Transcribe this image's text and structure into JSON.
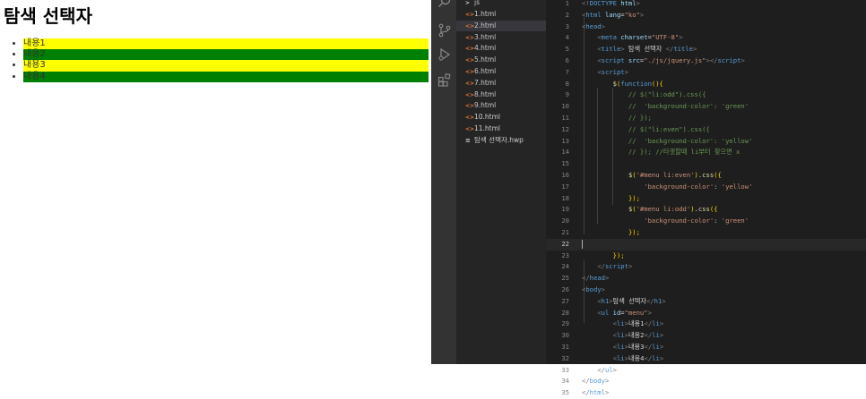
{
  "preview": {
    "title": "탐색 선택자",
    "items": [
      "내용1",
      "내용2",
      "내용3",
      "내용4"
    ],
    "even_color": "#ffff00",
    "odd_color": "#008000"
  },
  "activity_icons": [
    "search-icon",
    "source-control-icon",
    "run-debug-icon",
    "extensions-icon"
  ],
  "explorer": {
    "folder": "js",
    "files": [
      "1.html",
      "2.html",
      "3.html",
      "4.html",
      "5.html",
      "6.html",
      "7.html",
      "8.html",
      "9.html",
      "10.html",
      "11.html"
    ],
    "active_file": "2.html",
    "hwp_file": "탐색 선택자.hwp"
  },
  "code": {
    "lines": [
      {
        "n": "1",
        "t": [
          [
            "t-brk",
            "<!"
          ],
          [
            "t-tag",
            "DOCTYPE"
          ],
          [
            "t-attr",
            " html"
          ],
          [
            "t-brk",
            ">"
          ]
        ]
      },
      {
        "n": "2",
        "t": [
          [
            "t-brk",
            "<"
          ],
          [
            "t-tag",
            "html"
          ],
          [
            "t-attr",
            " lang"
          ],
          [
            "t-txt",
            "="
          ],
          [
            "t-str",
            "\"ko\""
          ],
          [
            "t-brk",
            ">"
          ]
        ]
      },
      {
        "n": "3",
        "t": [
          [
            "t-brk",
            "<"
          ],
          [
            "t-tag",
            "head"
          ],
          [
            "t-brk",
            ">"
          ]
        ]
      },
      {
        "n": "4",
        "t": [
          [
            "t-txt",
            "    "
          ],
          [
            "t-brk",
            "<"
          ],
          [
            "t-tag",
            "meta"
          ],
          [
            "t-attr",
            " charset"
          ],
          [
            "t-txt",
            "="
          ],
          [
            "t-str",
            "\"UTF-8\""
          ],
          [
            "t-brk",
            ">"
          ]
        ]
      },
      {
        "n": "5",
        "t": [
          [
            "t-txt",
            "    "
          ],
          [
            "t-brk",
            "<"
          ],
          [
            "t-tag",
            "title"
          ],
          [
            "t-brk",
            ">"
          ],
          [
            "t-txt",
            " 탐색 선택자 "
          ],
          [
            "t-brk",
            "</"
          ],
          [
            "t-tag",
            "title"
          ],
          [
            "t-brk",
            ">"
          ]
        ]
      },
      {
        "n": "6",
        "t": [
          [
            "t-txt",
            "    "
          ],
          [
            "t-brk",
            "<"
          ],
          [
            "t-tag",
            "script"
          ],
          [
            "t-attr",
            " src"
          ],
          [
            "t-txt",
            "="
          ],
          [
            "t-str",
            "\"./js/jquery.js\""
          ],
          [
            "t-brk",
            "></"
          ],
          [
            "t-tag",
            "script"
          ],
          [
            "t-brk",
            ">"
          ]
        ]
      },
      {
        "n": "7",
        "t": [
          [
            "t-txt",
            "    "
          ],
          [
            "t-brk",
            "<"
          ],
          [
            "t-tag",
            "script"
          ],
          [
            "t-brk",
            ">"
          ]
        ]
      },
      {
        "n": "8",
        "t": [
          [
            "t-txt",
            "        "
          ],
          [
            "t-fn",
            "$"
          ],
          [
            "t-par",
            "("
          ],
          [
            "t-kw",
            "function"
          ],
          [
            "t-par",
            "(){"
          ]
        ]
      },
      {
        "n": "9",
        "t": [
          [
            "t-com",
            "            // $(\"li:odd\").css({"
          ]
        ]
      },
      {
        "n": "10",
        "t": [
          [
            "t-com",
            "            //  'background-color': 'green'"
          ]
        ]
      },
      {
        "n": "11",
        "t": [
          [
            "t-com",
            "            // });"
          ]
        ]
      },
      {
        "n": "12",
        "t": [
          [
            "t-com",
            "            // $(\"li:even\").css({"
          ]
        ]
      },
      {
        "n": "13",
        "t": [
          [
            "t-com",
            "            //  'background-color': 'yellow'"
          ]
        ]
      },
      {
        "n": "14",
        "t": [
          [
            "t-com",
            "            // }); //타겟할때 li부터 찾으면 x"
          ]
        ]
      },
      {
        "n": "15",
        "t": []
      },
      {
        "n": "16",
        "t": [
          [
            "t-txt",
            "            "
          ],
          [
            "t-fn",
            "$"
          ],
          [
            "t-par",
            "("
          ],
          [
            "t-str",
            "'#menu li:even'"
          ],
          [
            "t-par",
            ")"
          ],
          [
            "t-txt",
            "."
          ],
          [
            "t-fn",
            "css"
          ],
          [
            "t-par",
            "({"
          ]
        ]
      },
      {
        "n": "17",
        "t": [
          [
            "t-txt",
            "                "
          ],
          [
            "t-str",
            "'background-color'"
          ],
          [
            "t-txt",
            ": "
          ],
          [
            "t-str",
            "'yellow'"
          ]
        ]
      },
      {
        "n": "18",
        "t": [
          [
            "t-txt",
            "            "
          ],
          [
            "t-par",
            "});"
          ]
        ]
      },
      {
        "n": "19",
        "t": [
          [
            "t-txt",
            "            "
          ],
          [
            "t-fn",
            "$"
          ],
          [
            "t-par",
            "("
          ],
          [
            "t-str",
            "'#menu li:odd'"
          ],
          [
            "t-par",
            ")"
          ],
          [
            "t-txt",
            "."
          ],
          [
            "t-fn",
            "css"
          ],
          [
            "t-par",
            "({"
          ]
        ]
      },
      {
        "n": "20",
        "t": [
          [
            "t-txt",
            "                "
          ],
          [
            "t-str",
            "'background-color'"
          ],
          [
            "t-txt",
            ": "
          ],
          [
            "t-str",
            "'green'"
          ]
        ]
      },
      {
        "n": "21",
        "t": [
          [
            "t-txt",
            "            "
          ],
          [
            "t-par",
            "});"
          ]
        ]
      },
      {
        "n": "22",
        "t": [],
        "current": true
      },
      {
        "n": "23",
        "t": [
          [
            "t-txt",
            "        "
          ],
          [
            "t-par",
            "});"
          ]
        ]
      },
      {
        "n": "24",
        "t": [
          [
            "t-txt",
            "    "
          ],
          [
            "t-brk",
            "</"
          ],
          [
            "t-tag",
            "script"
          ],
          [
            "t-brk",
            ">"
          ]
        ]
      },
      {
        "n": "25",
        "t": [
          [
            "t-brk",
            "</"
          ],
          [
            "t-tag",
            "head"
          ],
          [
            "t-brk",
            ">"
          ]
        ]
      },
      {
        "n": "26",
        "t": [
          [
            "t-brk",
            "<"
          ],
          [
            "t-tag",
            "body"
          ],
          [
            "t-brk",
            ">"
          ]
        ]
      },
      {
        "n": "27",
        "t": [
          [
            "t-txt",
            "    "
          ],
          [
            "t-brk",
            "<"
          ],
          [
            "t-tag",
            "h1"
          ],
          [
            "t-brk",
            ">"
          ],
          [
            "t-txt",
            "탐색 선택자"
          ],
          [
            "t-brk",
            "</"
          ],
          [
            "t-tag",
            "h1"
          ],
          [
            "t-brk",
            ">"
          ]
        ]
      },
      {
        "n": "28",
        "t": [
          [
            "t-txt",
            "    "
          ],
          [
            "t-brk",
            "<"
          ],
          [
            "t-tag",
            "ul"
          ],
          [
            "t-attr",
            " id"
          ],
          [
            "t-txt",
            "="
          ],
          [
            "t-str",
            "\"menu\""
          ],
          [
            "t-brk",
            ">"
          ]
        ]
      },
      {
        "n": "29",
        "t": [
          [
            "t-txt",
            "        "
          ],
          [
            "t-brk",
            "<"
          ],
          [
            "t-tag",
            "li"
          ],
          [
            "t-brk",
            ">"
          ],
          [
            "t-txt",
            "내용1"
          ],
          [
            "t-brk",
            "</"
          ],
          [
            "t-tag",
            "li"
          ],
          [
            "t-brk",
            ">"
          ]
        ]
      },
      {
        "n": "30",
        "t": [
          [
            "t-txt",
            "        "
          ],
          [
            "t-brk",
            "<"
          ],
          [
            "t-tag",
            "li"
          ],
          [
            "t-brk",
            ">"
          ],
          [
            "t-txt",
            "내용2"
          ],
          [
            "t-brk",
            "</"
          ],
          [
            "t-tag",
            "li"
          ],
          [
            "t-brk",
            ">"
          ]
        ]
      },
      {
        "n": "31",
        "t": [
          [
            "t-txt",
            "        "
          ],
          [
            "t-brk",
            "<"
          ],
          [
            "t-tag",
            "li"
          ],
          [
            "t-brk",
            ">"
          ],
          [
            "t-txt",
            "내용3"
          ],
          [
            "t-brk",
            "</"
          ],
          [
            "t-tag",
            "li"
          ],
          [
            "t-brk",
            ">"
          ]
        ]
      },
      {
        "n": "32",
        "t": [
          [
            "t-txt",
            "        "
          ],
          [
            "t-brk",
            "<"
          ],
          [
            "t-tag",
            "li"
          ],
          [
            "t-brk",
            ">"
          ],
          [
            "t-txt",
            "내용4"
          ],
          [
            "t-brk",
            "</"
          ],
          [
            "t-tag",
            "li"
          ],
          [
            "t-brk",
            ">"
          ]
        ]
      },
      {
        "n": "33",
        "t": [
          [
            "t-txt",
            "    "
          ],
          [
            "t-brk",
            "</"
          ],
          [
            "t-tag",
            "ul"
          ],
          [
            "t-brk",
            ">"
          ]
        ]
      },
      {
        "n": "34",
        "t": [
          [
            "t-brk",
            "</"
          ],
          [
            "t-tag",
            "body"
          ],
          [
            "t-brk",
            ">"
          ]
        ]
      },
      {
        "n": "35",
        "t": [
          [
            "t-brk",
            "</"
          ],
          [
            "t-tag",
            "html"
          ],
          [
            "t-brk",
            ">"
          ]
        ]
      }
    ]
  }
}
